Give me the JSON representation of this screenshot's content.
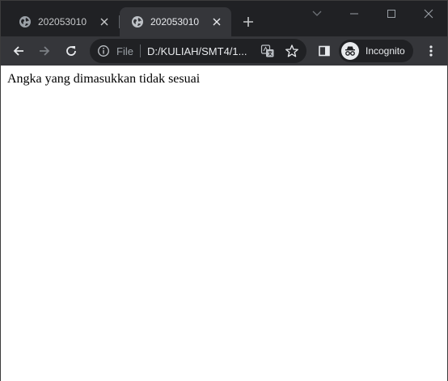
{
  "tabs": [
    {
      "title": "202053010",
      "active": false
    },
    {
      "title": "202053010",
      "active": true
    }
  ],
  "icons": {
    "tab_favicon": "globe-icon",
    "tab_close": "close-icon",
    "new_tab": "plus-icon",
    "tab_search": "chevron-down-icon",
    "minimize": "minimize-icon",
    "maximize": "maximize-icon",
    "close_window": "close-icon",
    "back": "arrow-left-icon",
    "forward": "arrow-right-icon",
    "reload": "reload-icon",
    "site_info": "info-icon",
    "translate": "translate-icon",
    "bookmark": "star-icon",
    "side_panel": "side-panel-icon",
    "incognito": "incognito-icon",
    "menu": "kebab-menu-icon"
  },
  "toolbar": {
    "scheme_label": "File",
    "url": "D:/KULIAH/SMT4/1...",
    "incognito_label": "Incognito"
  },
  "page": {
    "message": "Angka yang dimasukkan tidak sesuai"
  },
  "colors": {
    "frame": "#202124",
    "toolbar": "#35363a",
    "page_bg": "#ffffff",
    "text": "#e8eaed"
  }
}
